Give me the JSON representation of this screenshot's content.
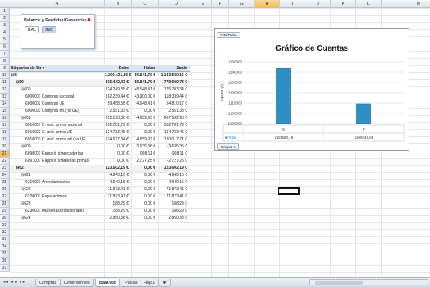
{
  "columns": [
    "A",
    "B",
    "C",
    "D",
    "E",
    "F",
    "G",
    "H",
    "I",
    "J",
    "K",
    "L",
    "M"
  ],
  "selected_column": "H",
  "rows": [
    "1",
    "2",
    "3",
    "4",
    "5",
    "6",
    "7",
    "8",
    "9",
    "10",
    "11",
    "12",
    "13",
    "14",
    "15",
    "16",
    "17",
    "18",
    "19",
    "20",
    "21",
    "22",
    "23",
    "24",
    "25",
    "26",
    "27",
    "28",
    "29",
    "30",
    "31",
    "32",
    "33",
    "34",
    "35",
    "36",
    "37"
  ],
  "selected_row": "21",
  "slicer": {
    "title": "Balance y Perdidas/Ganancias",
    "clear_icon": "clear-filter-icon",
    "items": [
      "BAL",
      "INC"
    ],
    "selected": "INC"
  },
  "pivot": {
    "header": {
      "label": "Etiquetas de fila",
      "debe": "Debe",
      "haber": "Haber",
      "saldo": "Saldo"
    },
    "lines": [
      {
        "label": "⊟6",
        "debe": "1.200.421,86 €",
        "haber": "56.841,70 €",
        "saldo": "1.143.580,16 €",
        "level": 0
      },
      {
        "label": "⊟60",
        "debe": "836.442,43 €",
        "haber": "56.841,70 €",
        "saldo": "779.600,73 €",
        "level": 1
      },
      {
        "label": "⊟600",
        "debe": "224.249,35 €",
        "haber": "48.548,41 €",
        "saldo": "175.703,34 €",
        "level": 2
      },
      {
        "label": "6000001 Compras nacional",
        "debe": "162.239,44 €",
        "haber": "43.900,00 €",
        "saldo": "118.339,44 €",
        "level": 3
      },
      {
        "label": "6000002 Compras UE",
        "debe": "59.458,58 €",
        "haber": "4.648,41 €",
        "saldo": "54.810,17 €",
        "level": 3
      },
      {
        "label": "6000003 Compras intl.(no UE)",
        "debe": "2.551,33 €",
        "haber": "0,00 €",
        "saldo": "2.551,33 €",
        "level": 3
      },
      {
        "label": "⊟601",
        "debe": "612.193,08 €",
        "haber": "4.659,93 €",
        "saldo": "607.532,95 €",
        "level": 2
      },
      {
        "label": "6010001 C. mat. prima nacional",
        "debe": "352.781,79 €",
        "haber": "0,00 €",
        "saldo": "352.781,79 €",
        "level": 3
      },
      {
        "label": "6010002 C. mat. prima UE",
        "debe": "134.733,45 €",
        "haber": "0,00 €",
        "saldo": "134.733,45 €",
        "level": 3
      },
      {
        "label": "6010003 C. mat. prima intl.(no UE)",
        "debe": "124.677,84 €",
        "haber": "4.659,93 €",
        "saldo": "120.017,71 €",
        "level": 3
      },
      {
        "label": "⊟609",
        "debe": "0,00 €",
        "haber": "3.635,36 €",
        "saldo": "-3.635,36 €",
        "level": 2
      },
      {
        "label": "6090001 Rappels s/mercaderías",
        "debe": "0,00 €",
        "haber": "908,11 €",
        "saldo": "-908,11 €",
        "level": 3
      },
      {
        "label": "6091001 Rappels s/materias primas",
        "debe": "0,00 €",
        "haber": "2.727,25 €",
        "saldo": "-2.727,25 €",
        "level": 3
      },
      {
        "label": "⊟62",
        "debe": "123.602,19 €",
        "haber": "0,00 €",
        "saldo": "123.602,19 €",
        "level": 1
      },
      {
        "label": "⊟621",
        "debe": "4.940,15 €",
        "haber": "0,00 €",
        "saldo": "4.940,15 €",
        "level": 2
      },
      {
        "label": "6210001 Arrendamientos",
        "debe": "4.940,15 €",
        "haber": "0,00 €",
        "saldo": "4.940,15 €",
        "level": 3
      },
      {
        "label": "⊟622",
        "debe": "71.873,41 €",
        "haber": "0,00 €",
        "saldo": "71.873,41 €",
        "level": 2
      },
      {
        "label": "6220001 Reparaciones",
        "debe": "71.873,41 €",
        "haber": "0,00 €",
        "saldo": "71.873,41 €",
        "level": 3
      },
      {
        "label": "⊟623",
        "debe": "188,29 €",
        "haber": "0,00 €",
        "saldo": "188,29 €",
        "level": 2
      },
      {
        "label": "6230001 Asesorías profesionales",
        "debe": "188,29 €",
        "haber": "0,00 €",
        "saldo": "188,29 €",
        "level": 3
      },
      {
        "label": "⊟624",
        "debe": "2.850,38 €",
        "haber": "0,00 €",
        "saldo": "2.850,38 €",
        "level": 2
      }
    ]
  },
  "chart": {
    "field_button_top": "Total Debe",
    "field_button_bottom": "Grupo2 ▾",
    "table_label": "■ Total"
  },
  "chart_data": {
    "type": "bar",
    "title": "Gráfico de Cuentas",
    "ylabel": "Importe (€)",
    "categories": [
      "6",
      "7"
    ],
    "values": [
      1143580.16,
      1109248.04
    ],
    "value_labels": [
      "1143580,16",
      "1109248,04"
    ],
    "ylim": [
      1090000,
      1150000
    ],
    "yticks": [
      "1150000",
      "1140000",
      "1130000",
      "1120000",
      "1110000",
      "1100000",
      "1090000"
    ],
    "grid": true,
    "color": "#2e8fc4"
  },
  "tabs": {
    "nav": "◂◂ ◂ ▸ ▸▸",
    "items": [
      "Compras",
      "Dimensiones",
      "Balance",
      "Plásas",
      "Hoja1"
    ],
    "active": "Balance",
    "new_sheet_icon": "new-sheet-icon"
  }
}
